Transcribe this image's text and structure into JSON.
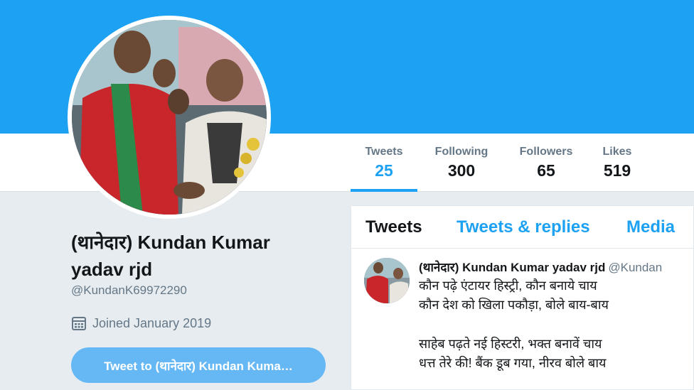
{
  "profile": {
    "display_name": "(थानेदार) Kundan Kumar yadav rjd",
    "handle": "@KundanK69972290",
    "joined": "Joined January 2019",
    "tweet_to_button": "Tweet to (थानेदार) Kundan Kuma…"
  },
  "stats": [
    {
      "label": "Tweets",
      "value": "25"
    },
    {
      "label": "Following",
      "value": "300"
    },
    {
      "label": "Followers",
      "value": "65"
    },
    {
      "label": "Likes",
      "value": "519"
    }
  ],
  "timeline": {
    "tabs": [
      {
        "label": "Tweets"
      },
      {
        "label": "Tweets & replies"
      },
      {
        "label": "Media"
      }
    ],
    "tweet": {
      "name": "(थानेदार) Kundan Kumar yadav rjd",
      "handle": "@Kundan",
      "lines": [
        "कौन पढ़े एंटायर हिस्ट्री, कौन बनाये चाय",
        "कौन देश को खिला पकौड़ा, बोले बाय-बाय",
        "साहेब पढ़ते नई हिस्टरी, भक्त बनावें चाय",
        "धत्त तेरे की! बैंक डूब गया, नीरव बोले बाय"
      ]
    }
  },
  "icons": {
    "joined": "calendar-icon"
  },
  "colors": {
    "brand_blue": "#1da1f2",
    "button_blue": "#66b8f5",
    "muted_text": "#657786"
  }
}
